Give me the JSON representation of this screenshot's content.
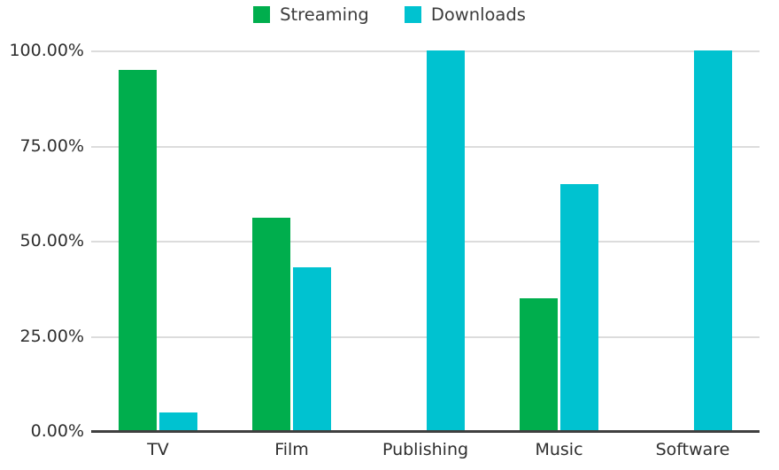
{
  "chart_data": {
    "type": "bar",
    "title": "",
    "subtitle": "",
    "xlabel": "",
    "ylabel": "",
    "categories": [
      "TV",
      "Film",
      "Publishing",
      "Music",
      "Software"
    ],
    "series": [
      {
        "name": "Streaming",
        "color": "#00AE4D",
        "values": [
          95,
          56,
          0,
          35,
          0
        ]
      },
      {
        "name": "Downloads",
        "color": "#00C2D0",
        "values": [
          5,
          43,
          100,
          65,
          100
        ]
      }
    ],
    "ylim": [
      0,
      100
    ],
    "ytick_values": [
      0,
      25,
      50,
      75,
      100
    ],
    "ytick_labels": [
      "0.00%",
      "25.00%",
      "50.00%",
      "75.00%",
      "100.00%"
    ],
    "value_format": "percent",
    "grid": true,
    "grid_color": "#dcdcdc",
    "axis_color": "#3f3f3f",
    "legend_position": "top-center",
    "background_color": "#ffffff",
    "text_color": "#2e2e2e"
  },
  "legend": {
    "items": [
      {
        "label": "Streaming",
        "color": "#00AE4D"
      },
      {
        "label": "Downloads",
        "color": "#00C2D0"
      }
    ]
  }
}
